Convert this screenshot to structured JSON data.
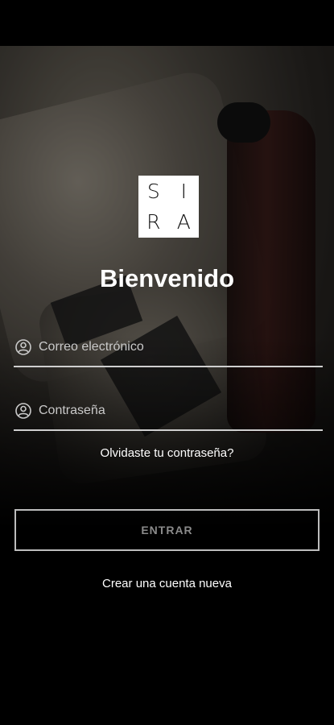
{
  "brand": {
    "logo_letters": [
      "S",
      "I",
      "R",
      "A"
    ]
  },
  "welcome": {
    "title": "Bienvenido"
  },
  "form": {
    "email": {
      "placeholder": "Correo electrónico",
      "value": "",
      "icon": "user-circle-icon"
    },
    "password": {
      "placeholder": "Contraseña",
      "value": "",
      "icon": "user-circle-icon"
    },
    "forgot_label": "Olvidaste tu contraseña?",
    "submit_label": "ENTRAR",
    "create_account_label": "Crear una cuenta nueva"
  },
  "colors": {
    "background": "#000000",
    "text": "#ffffff",
    "input_underline": "#cfcfcf",
    "button_border": "#bdbdbd",
    "button_text_disabled": "#8a8a8a"
  }
}
